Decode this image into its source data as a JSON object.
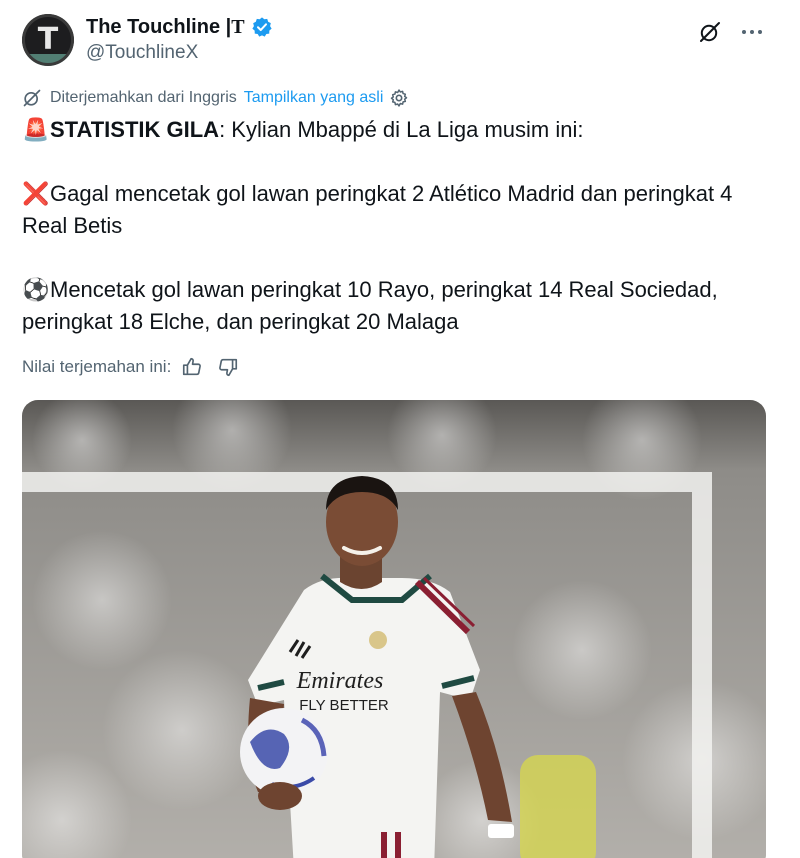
{
  "author": {
    "display_name": "The Touchline | ",
    "name_suffix": "T",
    "handle": "@TouchlineX",
    "avatar_letter": "T",
    "verified_color": "#1d9bf0"
  },
  "translation": {
    "label": "Diterjemahkan dari Inggris",
    "show_original": "Tampilkan yang asli",
    "link_color": "#1d9bf0"
  },
  "post": {
    "line1_emoji": "🚨",
    "line1_bold": "STATISTIK GILA",
    "line1_rest": ": Kylian Mbappé di La Liga musim ini:",
    "line2_emoji": "❌",
    "line2_text": "Gagal mencetak gol lawan peringkat 2 Atlético Madrid dan peringkat 4 Real Betis",
    "line3_emoji": "⚽",
    "line3_text": "Mencetak gol lawan peringkat 10 Rayo, peringkat 14 Real Sociedad, peringkat 18 Elche, dan peringkat 20 Malaga"
  },
  "rating": {
    "label": "Nilai terjemahan ini:"
  },
  "media": {
    "shirt_sponsor_line1": "Emirates",
    "shirt_sponsor_line2": "FLY BETTER"
  },
  "icons": {
    "grok": "grok-icon",
    "more": "more-icon",
    "translate": "translate-icon",
    "settings": "gear-icon",
    "thumbs_up": "thumbs-up-icon",
    "thumbs_down": "thumbs-down-icon"
  }
}
